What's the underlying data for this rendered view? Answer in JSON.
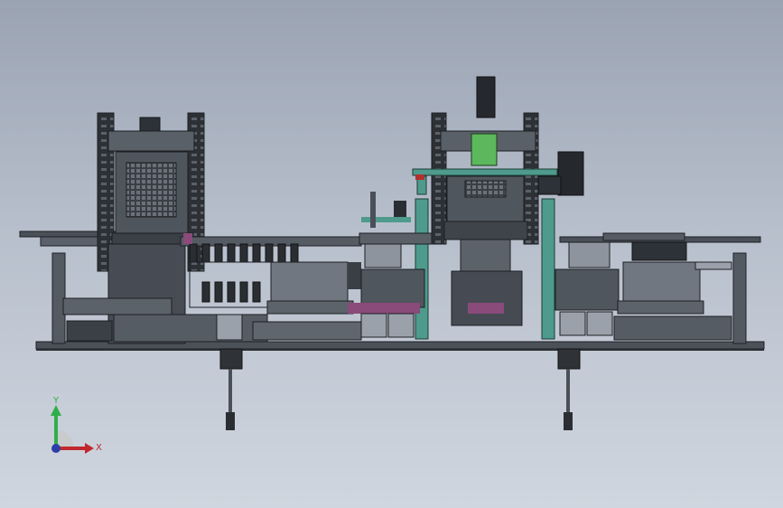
{
  "viewport": {
    "background_top": "#9aa3b2",
    "background_bottom": "#d0d6df",
    "model_color": "#4b5058",
    "frame_color": "#2f343a",
    "accent_green": "#4e9a8c",
    "accent_bright_green": "#5cb85c",
    "accent_purple": "#8a4a7a"
  },
  "axis_triad": {
    "x_label": "X",
    "y_label": "Y",
    "x_color": "#c0282d",
    "y_color": "#2fae4a",
    "z_color": "#2b3ea8"
  }
}
